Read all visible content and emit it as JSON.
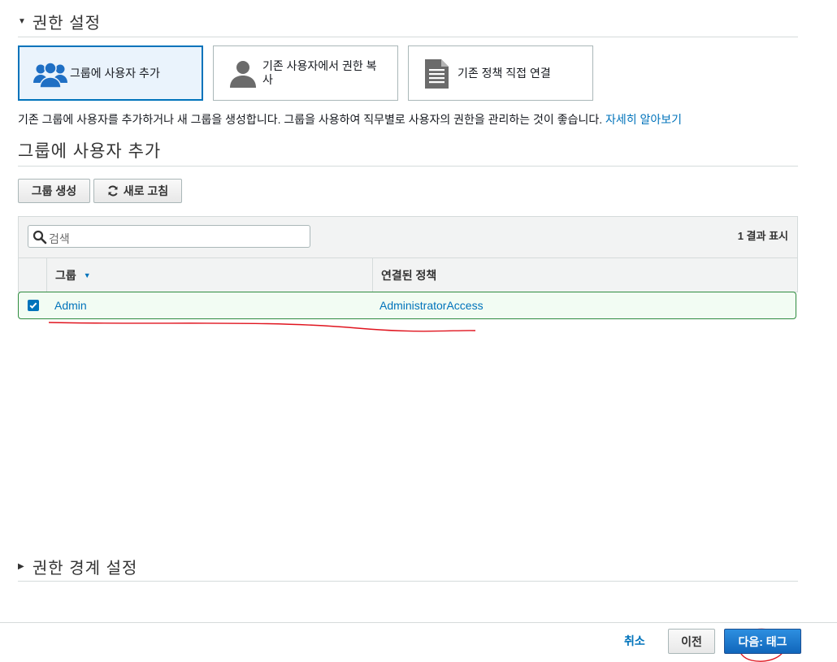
{
  "permissions_header": {
    "title": "권한 설정"
  },
  "options": [
    {
      "label": "그룹에 사용자 추가",
      "icon": "group-icon",
      "selected": true
    },
    {
      "label": "기존 사용자에서 권한 복사",
      "icon": "user-icon",
      "selected": false
    },
    {
      "label": "기존 정책 직접 연결",
      "icon": "document-icon",
      "selected": false
    }
  ],
  "description": {
    "text": "기존 그룹에 사용자를 추가하거나 새 그룹을 생성합니다. 그룹을 사용하여 직무별로 사용자의 권한을 관리하는 것이 좋습니다. ",
    "link": "자세히 알아보기"
  },
  "add_section": {
    "title": "그룹에 사용자 추가"
  },
  "toolbar": {
    "create_group": "그룹 생성",
    "refresh": "새로 고침"
  },
  "table": {
    "search_placeholder": "검색",
    "result_count": "1 결과 표시",
    "columns": {
      "group": "그룹",
      "policy": "연결된 정책"
    },
    "rows": [
      {
        "group": "Admin",
        "policy": "AdministratorAccess",
        "checked": true
      }
    ]
  },
  "boundary_header": {
    "title": "권한 경계 설정"
  },
  "footer": {
    "cancel": "취소",
    "previous": "이전",
    "next": "다음: 태그"
  },
  "colors": {
    "accent": "#0073bb",
    "selected_row_border": "#2e8b3f",
    "annotation_red": "#e0141e"
  }
}
